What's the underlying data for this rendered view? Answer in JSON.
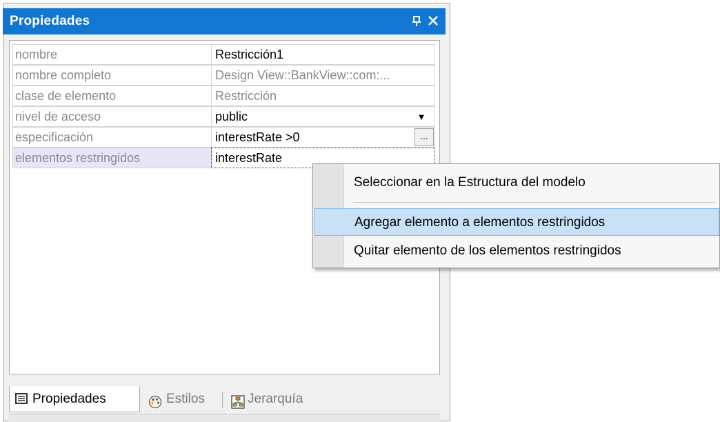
{
  "window": {
    "title": "Propiedades",
    "pin_icon": "pin-icon",
    "close_icon": "close-icon"
  },
  "properties": [
    {
      "name": "nombre",
      "value": "Restricción1"
    },
    {
      "name": "nombre completo",
      "value": "Design View::BankView::com:..."
    },
    {
      "name": "clase de elemento",
      "value": "Restricción"
    },
    {
      "name": "nivel de acceso",
      "value": "public"
    },
    {
      "name": "especificación",
      "value": "interestRate >0",
      "button": "..."
    },
    {
      "name": "elementos restringidos",
      "value": "interestRate"
    }
  ],
  "tabs": [
    {
      "label": "Propiedades",
      "icon": "properties-icon",
      "active": true
    },
    {
      "label": "Estilos",
      "icon": "palette-icon",
      "active": false
    },
    {
      "label": "Jerarquía",
      "icon": "hierarchy-icon",
      "active": false
    }
  ],
  "context_menu": {
    "items": [
      {
        "label": "Seleccionar en la Estructura del modelo"
      },
      {
        "label": "Agregar elemento a elementos restringidos",
        "highlighted": true
      },
      {
        "label": "Quitar elemento de los elementos restringidos"
      }
    ]
  },
  "colors": {
    "titlebar": "#1276d3",
    "selected_row": "#e6e6f8",
    "menu_hover": "#c8e1f7"
  }
}
